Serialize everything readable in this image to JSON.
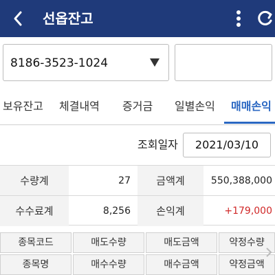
{
  "header": {
    "title": "선옵잔고",
    "icons": {
      "back": "chevron-left-icon",
      "more": "more-vertical-icon",
      "refresh": "refresh-icon"
    },
    "bg_color": "#1f3a7a"
  },
  "account": {
    "number": "8186-3523-1024",
    "password_value": ""
  },
  "tabs": [
    {
      "label": "보유잔고",
      "active": false
    },
    {
      "label": "체결내역",
      "active": false
    },
    {
      "label": "증거금",
      "active": false
    },
    {
      "label": "일별손익",
      "active": false
    },
    {
      "label": "매매손익",
      "active": true
    }
  ],
  "query": {
    "date_label": "조회일자",
    "date_value": "2021/03/10"
  },
  "summary": {
    "qty_label": "수량계",
    "qty_value": "27",
    "amount_label": "금액계",
    "amount_value": "550,388,000",
    "fee_label": "수수료계",
    "fee_value": "8,256",
    "pnl_label": "손익계",
    "pnl_value": "+179,000"
  },
  "table_headers": {
    "row1": [
      "종목코드",
      "매도수량",
      "매도금액",
      "약정수량"
    ],
    "row2": [
      "종목명",
      "매수수량",
      "매수금액",
      "약정금액"
    ]
  },
  "colors": {
    "accent": "#2a67c2",
    "profit": "#d02828"
  }
}
